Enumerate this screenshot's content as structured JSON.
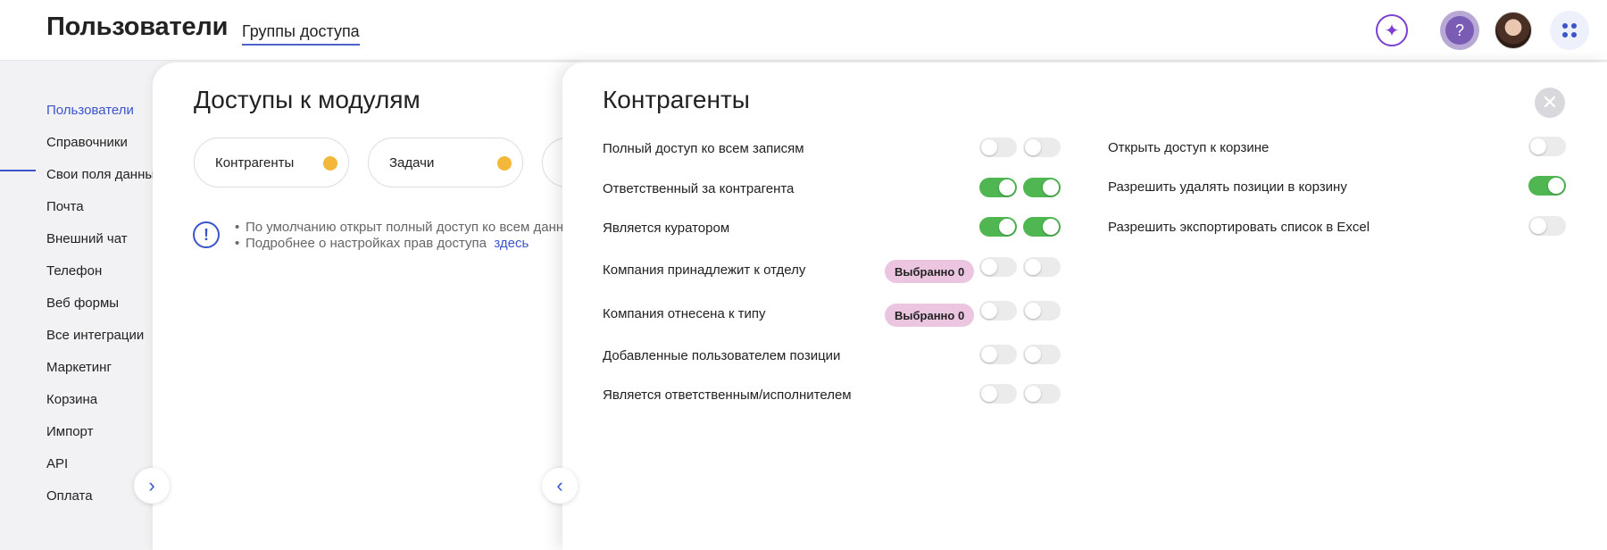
{
  "header": {
    "app_title": "Пользователи",
    "tab_label": "Группы доступа",
    "help_symbol": "?",
    "ai_symbol": "✦"
  },
  "sidebar": {
    "items": [
      {
        "label": "Пользователи",
        "active": true
      },
      {
        "label": "Справочники"
      },
      {
        "label": "Свои поля данных"
      },
      {
        "label": "Почта"
      },
      {
        "label": "Внешний чат"
      },
      {
        "label": "Телефон"
      },
      {
        "label": "Веб формы"
      },
      {
        "label": "Все интеграции"
      },
      {
        "label": "Маркетинг"
      },
      {
        "label": "Корзина"
      },
      {
        "label": "Импорт"
      },
      {
        "label": "API"
      },
      {
        "label": "Оплата"
      }
    ]
  },
  "modules": {
    "title": "Доступы к модулям",
    "pills": [
      {
        "label": "Контрагенты"
      },
      {
        "label": "Задачи"
      }
    ],
    "info": {
      "line1": "По умолчанию открыт полный доступ ко всем данны",
      "line2": "Подробнее о настройках прав доступа",
      "link": "здесь"
    }
  },
  "drawer": {
    "title": "Контрагенты",
    "close_symbol": "✕",
    "left_permissions": [
      {
        "label": "Полный доступ ко всем записям",
        "toggles": [
          false,
          false
        ]
      },
      {
        "label": "Ответственный за контрагента",
        "toggles": [
          true,
          true
        ]
      },
      {
        "label": "Является куратором",
        "toggles": [
          true,
          true
        ]
      },
      {
        "label": "Компания принадлежит к отделу",
        "badge": "Выбранно 0",
        "toggles": [
          false,
          false
        ]
      },
      {
        "label": "Компания отнесена к типу",
        "badge": "Выбранно 0",
        "toggles": [
          false,
          false
        ]
      },
      {
        "label": "Добавленные пользователем позиции",
        "toggles": [
          false,
          false
        ]
      },
      {
        "label": "Является ответственным/исполнителем",
        "toggles": [
          false,
          false
        ]
      }
    ],
    "right_permissions": [
      {
        "label": "Открыть доступ к корзине",
        "toggle": false
      },
      {
        "label": "Разрешить удалять позиции в корзину",
        "toggle": true
      },
      {
        "label": "Разрешить экспортировать список в Excel",
        "toggle": false
      }
    ]
  },
  "colors": {
    "accent": "#3b54c9",
    "toggle_on": "#4fb652",
    "badge_bg": "#ecc6e1",
    "module_dot": "#f3b83a"
  }
}
